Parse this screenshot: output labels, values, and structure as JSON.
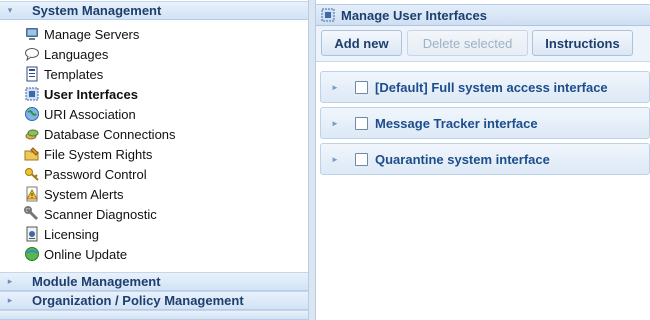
{
  "sidebar": {
    "sections": [
      {
        "label": "System Management",
        "expanded": true
      },
      {
        "label": "Module Management",
        "expanded": false
      },
      {
        "label": "Organization / Policy Management",
        "expanded": false
      }
    ],
    "items": [
      {
        "label": "Manage Servers",
        "icon": "server-icon"
      },
      {
        "label": "Languages",
        "icon": "speech-bubble-icon"
      },
      {
        "label": "Templates",
        "icon": "template-icon"
      },
      {
        "label": "User Interfaces",
        "icon": "user-interface-icon",
        "active": true
      },
      {
        "label": "URI Association",
        "icon": "globe-icon"
      },
      {
        "label": "Database Connections",
        "icon": "database-icon"
      },
      {
        "label": "File System Rights",
        "icon": "folder-edit-icon"
      },
      {
        "label": "Password Control",
        "icon": "key-icon"
      },
      {
        "label": "System Alerts",
        "icon": "warning-icon"
      },
      {
        "label": "Scanner Diagnostic",
        "icon": "wrench-icon"
      },
      {
        "label": "Licensing",
        "icon": "license-icon"
      },
      {
        "label": "Online Update",
        "icon": "update-globe-icon"
      }
    ]
  },
  "main": {
    "title": "Manage User Interfaces",
    "toolbar": {
      "add_label": "Add new",
      "delete_label": "Delete selected",
      "instructions_label": "Instructions"
    },
    "rows": [
      {
        "label": "[Default] Full system access interface",
        "checked": false
      },
      {
        "label": "Message Tracker interface",
        "checked": false
      },
      {
        "label": "Quarantine system interface",
        "checked": false
      }
    ]
  },
  "colors": {
    "header_text": "#1e3f6e",
    "row_text": "#1e4d8c",
    "header_bg": "#d3e3f5",
    "disabled_text": "#9fb1c6"
  }
}
